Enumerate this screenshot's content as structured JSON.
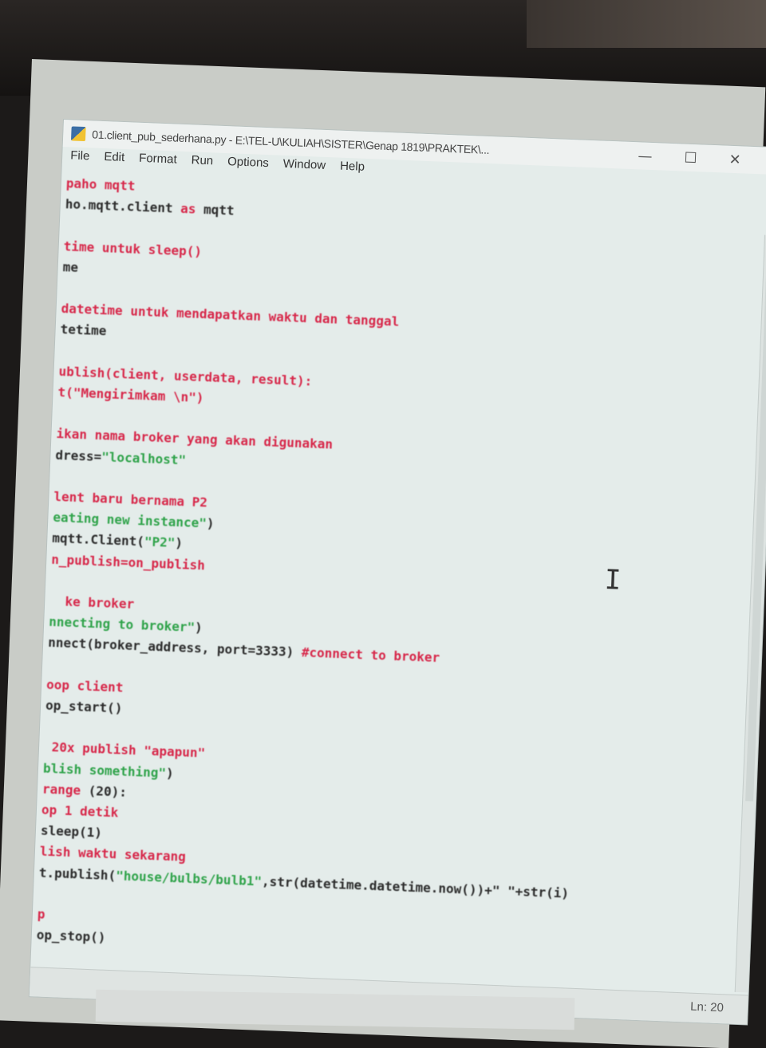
{
  "window": {
    "title": "01.client_pub_sederhana.py - E:\\TEL-U\\KULIAH\\SISTER\\Genap 1819\\PRAKTEK\\...",
    "controls": {
      "minimize": "—",
      "maximize": "☐",
      "close": "✕"
    }
  },
  "menu": [
    "File",
    "Edit",
    "Format",
    "Run",
    "Options",
    "Window",
    "Help"
  ],
  "code_lines": [
    [
      {
        "t": "paho mqtt",
        "c": "kw"
      }
    ],
    [
      {
        "t": "ho.mqtt.client ",
        "c": ""
      },
      {
        "t": "as",
        "c": "kw"
      },
      {
        "t": " mqtt",
        "c": ""
      }
    ],
    [],
    [
      {
        "t": "time untuk sleep()",
        "c": "cm"
      }
    ],
    [
      {
        "t": "me",
        "c": ""
      }
    ],
    [],
    [
      {
        "t": "datetime untuk mendapatkan waktu dan tanggal",
        "c": "cm"
      }
    ],
    [
      {
        "t": "tetime",
        "c": ""
      }
    ],
    [],
    [
      {
        "t": "ublish(client, userdata, result):",
        "c": "kw"
      }
    ],
    [
      {
        "t": "t(\"Mengirimkam \\n\")",
        "c": "kw"
      }
    ],
    [],
    [
      {
        "t": "ikan nama broker yang akan digunakan",
        "c": "cm"
      }
    ],
    [
      {
        "t": "dress=",
        "c": ""
      },
      {
        "t": "\"localhost\"",
        "c": "st"
      }
    ],
    [],
    [
      {
        "t": "lent baru bernama P2",
        "c": "cm"
      }
    ],
    [
      {
        "t": "eating new instance\"",
        "c": "st"
      },
      {
        "t": ")",
        "c": ""
      }
    ],
    [
      {
        "t": "mqtt.Client(",
        "c": ""
      },
      {
        "t": "\"P2\"",
        "c": "st"
      },
      {
        "t": ")",
        "c": ""
      }
    ],
    [
      {
        "t": "n_publish=on_publish",
        "c": "kw"
      }
    ],
    [],
    [
      {
        "t": "  ke broker",
        "c": "cm"
      }
    ],
    [
      {
        "t": "nnecting to broker\"",
        "c": "st"
      },
      {
        "t": ")",
        "c": ""
      }
    ],
    [
      {
        "t": "nnect(broker_address, port=3333) ",
        "c": ""
      },
      {
        "t": "#connect to broker",
        "c": "cm"
      }
    ],
    [],
    [
      {
        "t": "oop client",
        "c": "cm"
      }
    ],
    [
      {
        "t": "op_start()",
        "c": ""
      }
    ],
    [],
    [
      {
        "t": " 20x publish \"apapun\"",
        "c": "cm"
      }
    ],
    [
      {
        "t": "blish something\"",
        "c": "st"
      },
      {
        "t": ")",
        "c": ""
      }
    ],
    [
      {
        "t": "range",
        "c": "kw"
      },
      {
        "t": " (20):",
        "c": ""
      }
    ],
    [
      {
        "t": "op 1 detik",
        "c": "cm"
      }
    ],
    [
      {
        "t": "sleep(1)",
        "c": ""
      }
    ],
    [
      {
        "t": "lish waktu sekarang",
        "c": "cm"
      }
    ],
    [
      {
        "t": "t.publish(",
        "c": ""
      },
      {
        "t": "\"house/bulbs/bulb1\"",
        "c": "st"
      },
      {
        "t": ",str(datetime.datetime.now())+\" \"+str(i)",
        "c": ""
      }
    ],
    [],
    [
      {
        "t": "p",
        "c": "kw"
      }
    ],
    [
      {
        "t": "op_stop()",
        "c": ""
      }
    ]
  ],
  "status": {
    "position": "Ln: 20"
  },
  "colors": {
    "keyword": "#d7284a",
    "string": "#2fa34a",
    "text": "#2c2c2c",
    "editor_bg": "#e4ecea"
  }
}
